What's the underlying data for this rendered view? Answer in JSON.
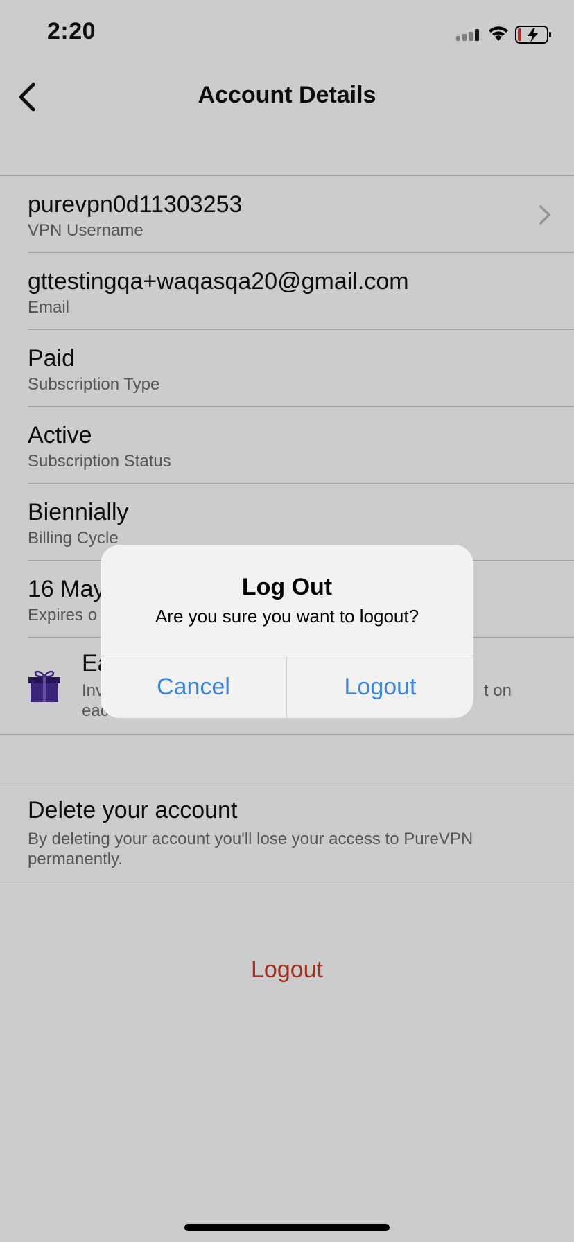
{
  "status_bar": {
    "time": "2:20",
    "icons": [
      "cellular-signal-icon",
      "wifi-icon",
      "battery-charging-icon"
    ]
  },
  "nav": {
    "title": "Account Details",
    "back_icon": "chevron-left-icon"
  },
  "account_rows": [
    {
      "value": "purevpn0d11303253",
      "label": "VPN Username",
      "has_chevron": true
    },
    {
      "value": "gttestingqa+waqasqa20@gmail.com",
      "label": "Email"
    },
    {
      "value": "Paid",
      "label": "Subscription Type"
    },
    {
      "value": "Active",
      "label": "Subscription Status"
    },
    {
      "value": "Biennially",
      "label": "Billing Cycle"
    },
    {
      "value": "16 May",
      "label": "Expires o"
    }
  ],
  "earn": {
    "icon": "gift-icon",
    "title": "Ea",
    "description_left": "Inv",
    "description_left_2": "eac",
    "description_right": "t on"
  },
  "delete_account": {
    "title": "Delete your account",
    "description": "By deleting your account you'll lose your access to PureVPN permanently."
  },
  "logout_label": "Logout",
  "alert": {
    "title": "Log Out",
    "message": "Are you sure you want to logout?",
    "cancel_label": "Cancel",
    "confirm_label": "Logout"
  },
  "colors": {
    "destructive": "#d13b24",
    "alert_action": "#3a86e0",
    "gift": "#4b2d9a"
  }
}
